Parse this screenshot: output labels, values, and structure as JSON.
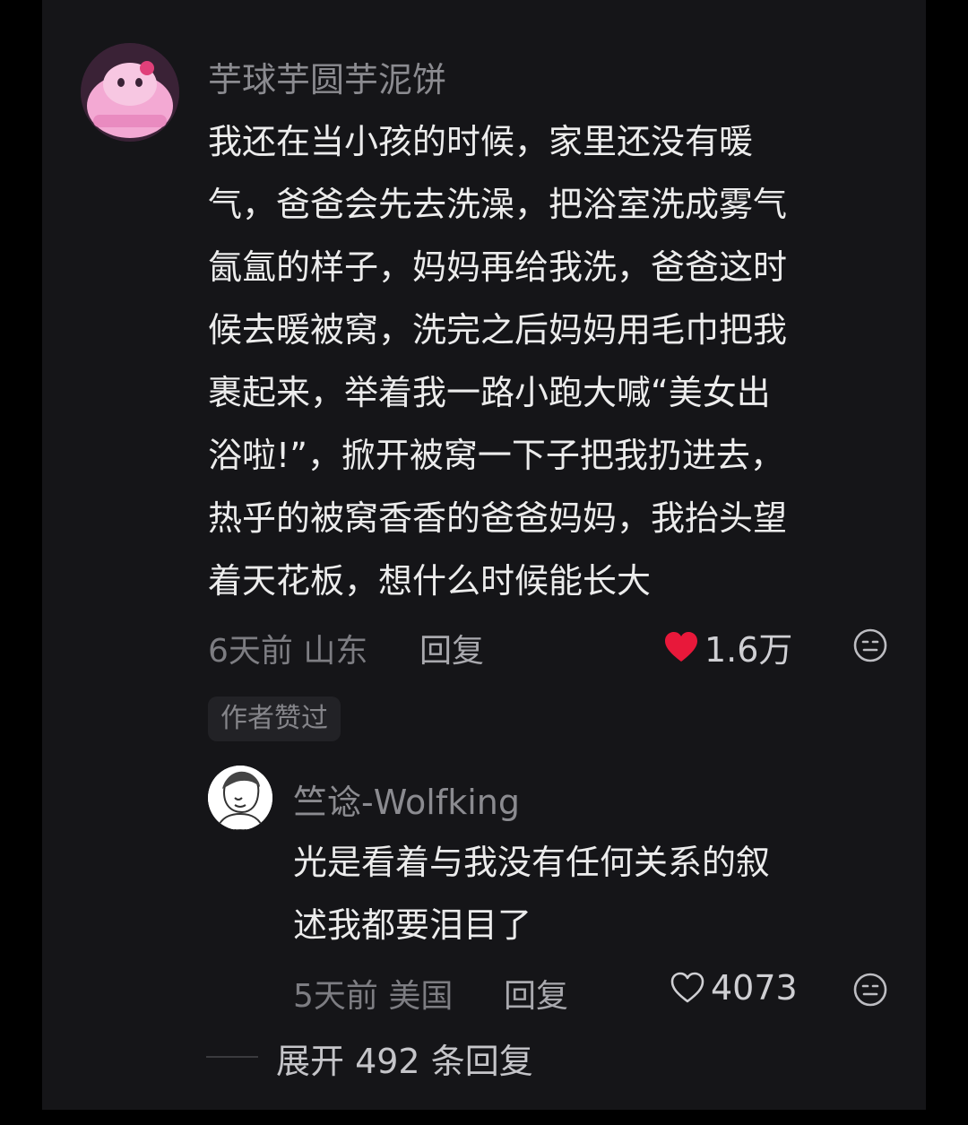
{
  "comment": {
    "username": "芋球芋圆芋泥饼",
    "lines": [
      "我还在当小孩的时候，家里还没有暖",
      "气，爸爸会先去洗澡，把浴室洗成雾气",
      "氤氲的样子，妈妈再给我洗，爸爸这时",
      "候去暖被窝，洗完之后妈妈用毛巾把我",
      "裹起来，举着我一路小跑大喊“美女出",
      "浴啦!”，掀开被窝一下子把我扔进去，",
      "热乎的被窝香香的爸爸妈妈，我抬头望",
      "着天花板，想什么时候能长大"
    ],
    "time_location": "6天前 山东",
    "reply_label": "回复",
    "likes": "1.6万",
    "liked": true,
    "heart_icon": "heart-filled-icon",
    "smile_icon": "smile-icon",
    "author_badge": "作者赞过"
  },
  "reply": {
    "username": "竺谂-Wolfking",
    "lines": [
      "光是看着与我没有任何关系的叙",
      "述我都要泪目了"
    ],
    "time_location": "5天前 美国",
    "reply_label": "回复",
    "likes": "4073",
    "liked": false,
    "heart_icon": "heart-outline-icon",
    "smile_icon": "smile-icon"
  },
  "expand_replies": "展开 492 条回复",
  "colors": {
    "background": "#151518",
    "heart": "#e8183a",
    "muted_text": "#8b8b90",
    "body_text": "#ececec"
  }
}
